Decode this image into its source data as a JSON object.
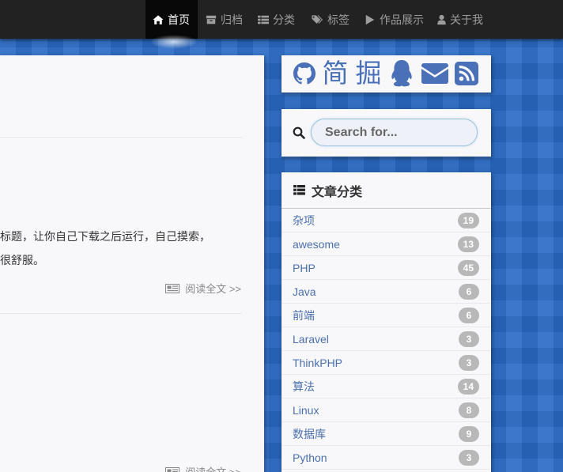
{
  "nav": {
    "items": [
      {
        "label": "首页",
        "icon": "home-icon",
        "active": true
      },
      {
        "label": "归档",
        "icon": "archive-icon"
      },
      {
        "label": "分类",
        "icon": "list-icon"
      },
      {
        "label": "标签",
        "icon": "tags-icon"
      },
      {
        "label": "作品展示",
        "icon": "play-icon"
      },
      {
        "label": "关于我",
        "icon": "user-icon"
      }
    ]
  },
  "post": {
    "excerpt_line1": "标题，让你自己下载之后运行，自己摸索，",
    "excerpt_line2": "很舒服。",
    "read_more": "阅读全文 >>",
    "read_more_2": "阅读全文 >>"
  },
  "social": {
    "icons": [
      "github-icon",
      "jianshu-icon",
      "juejin-icon",
      "qq-icon",
      "mail-icon",
      "rss-icon"
    ],
    "jianshu_text": "简",
    "juejin_text": "掘"
  },
  "search": {
    "placeholder": "Search for..."
  },
  "categories": {
    "title": "文章分类",
    "items": [
      {
        "label": "杂项",
        "count": "19"
      },
      {
        "label": "awesome",
        "count": "13"
      },
      {
        "label": "PHP",
        "count": "45"
      },
      {
        "label": "Java",
        "count": "6"
      },
      {
        "label": "前端",
        "count": "6"
      },
      {
        "label": "Laravel",
        "count": "3"
      },
      {
        "label": "ThinkPHP",
        "count": "3"
      },
      {
        "label": "算法",
        "count": "14"
      },
      {
        "label": "Linux",
        "count": "8"
      },
      {
        "label": "数据库",
        "count": "9"
      },
      {
        "label": "Python",
        "count": "3"
      }
    ]
  },
  "colors": {
    "navbar": "#222222",
    "nav_active": "#080808",
    "accent_blue": "#4a70b8",
    "link": "#4a6fae",
    "badge": "#b8b8b8",
    "background": "#2a6ac6"
  }
}
